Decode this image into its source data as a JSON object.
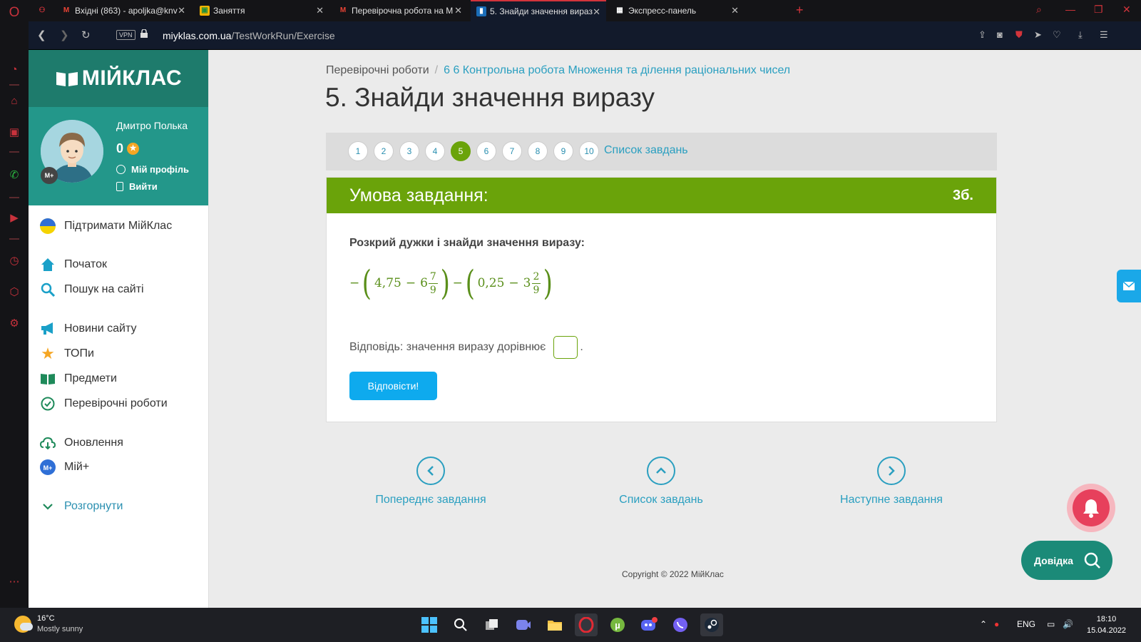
{
  "browser": {
    "tabs": [
      {
        "title": "Вхідні (863) - apoljka@knv",
        "favicon": "gmail-icon"
      },
      {
        "title": "Заняття",
        "favicon": "classroom-icon"
      },
      {
        "title": "Перевірочна робота на М",
        "favicon": "gmail-icon"
      },
      {
        "title": "5. Знайди значення вираз",
        "favicon": "miyklas-icon"
      },
      {
        "title": "Экспресс-панель",
        "favicon": "speed-dial-icon"
      }
    ],
    "url_domain": "miyklas.com.ua",
    "url_path": "/TestWorkRun/Exercise",
    "vpn_label": "VPN"
  },
  "site": {
    "brand": "МІЙКЛАС",
    "user": {
      "name": "Дмитро Полька",
      "points": "0",
      "profile_link": "Мій профіль",
      "logout_link": "Вийти",
      "badge": "M+"
    },
    "menu": [
      {
        "label": "Підтримати МійКлас",
        "icon": "ukraine-flag-icon"
      },
      {
        "label": "Початок",
        "icon": "home-icon"
      },
      {
        "label": "Пошук на сайті",
        "icon": "search-icon"
      },
      {
        "label": "Новини сайту",
        "icon": "megaphone-icon"
      },
      {
        "label": "ТОПи",
        "icon": "star-icon"
      },
      {
        "label": "Предмети",
        "icon": "book-icon"
      },
      {
        "label": "Перевірочні роботи",
        "icon": "check-circle-icon"
      },
      {
        "label": "Оновлення",
        "icon": "cloud-update-icon"
      },
      {
        "label": "Мій+",
        "icon": "miy-plus-icon"
      },
      {
        "label": "Розгорнути",
        "icon": "chevron-down-icon"
      }
    ]
  },
  "main": {
    "breadcrumb": {
      "root": "Перевірочні роботи",
      "current": "6 6 Контрольна робота Множення та ділення раціональних чисел"
    },
    "title": "5. Знайди значення виразу",
    "pager": {
      "pages": [
        "1",
        "2",
        "3",
        "4",
        "5",
        "6",
        "7",
        "8",
        "9",
        "10"
      ],
      "current": "5",
      "list_label": "Список завдань"
    },
    "task": {
      "header": "Умова завдання:",
      "points": "3б.",
      "question": "Розкрий дужки і знайди значення виразу:",
      "expression": {
        "lead_sign": "−",
        "a": "4,75",
        "minus1": "−",
        "b_whole": "6",
        "b_num": "7",
        "b_den": "9",
        "mid_sign": "−",
        "c": "0,25",
        "minus2": "−",
        "d_whole": "3",
        "d_num": "2",
        "d_den": "9"
      },
      "answer_label": "Відповідь: значення виразу дорівнює",
      "answer_value": "",
      "answer_suffix": ".",
      "submit_label": "Відповісти!"
    },
    "nav": {
      "prev": "Попереднє завдання",
      "list": "Список завдань",
      "next": "Наступне завдання"
    },
    "copyright": "Copyright © 2022 МійКлас",
    "help_label": "Довідка"
  },
  "taskbar": {
    "temperature": "16°C",
    "weather": "Mostly sunny",
    "lang": "ENG",
    "time": "18:10",
    "date": "15.04.2022"
  },
  "colors": {
    "accent_green": "#6aa30a",
    "teal": "#23978a",
    "link": "#2a9fc0",
    "button": "#0eaaee",
    "opera_red": "#d3343b"
  }
}
